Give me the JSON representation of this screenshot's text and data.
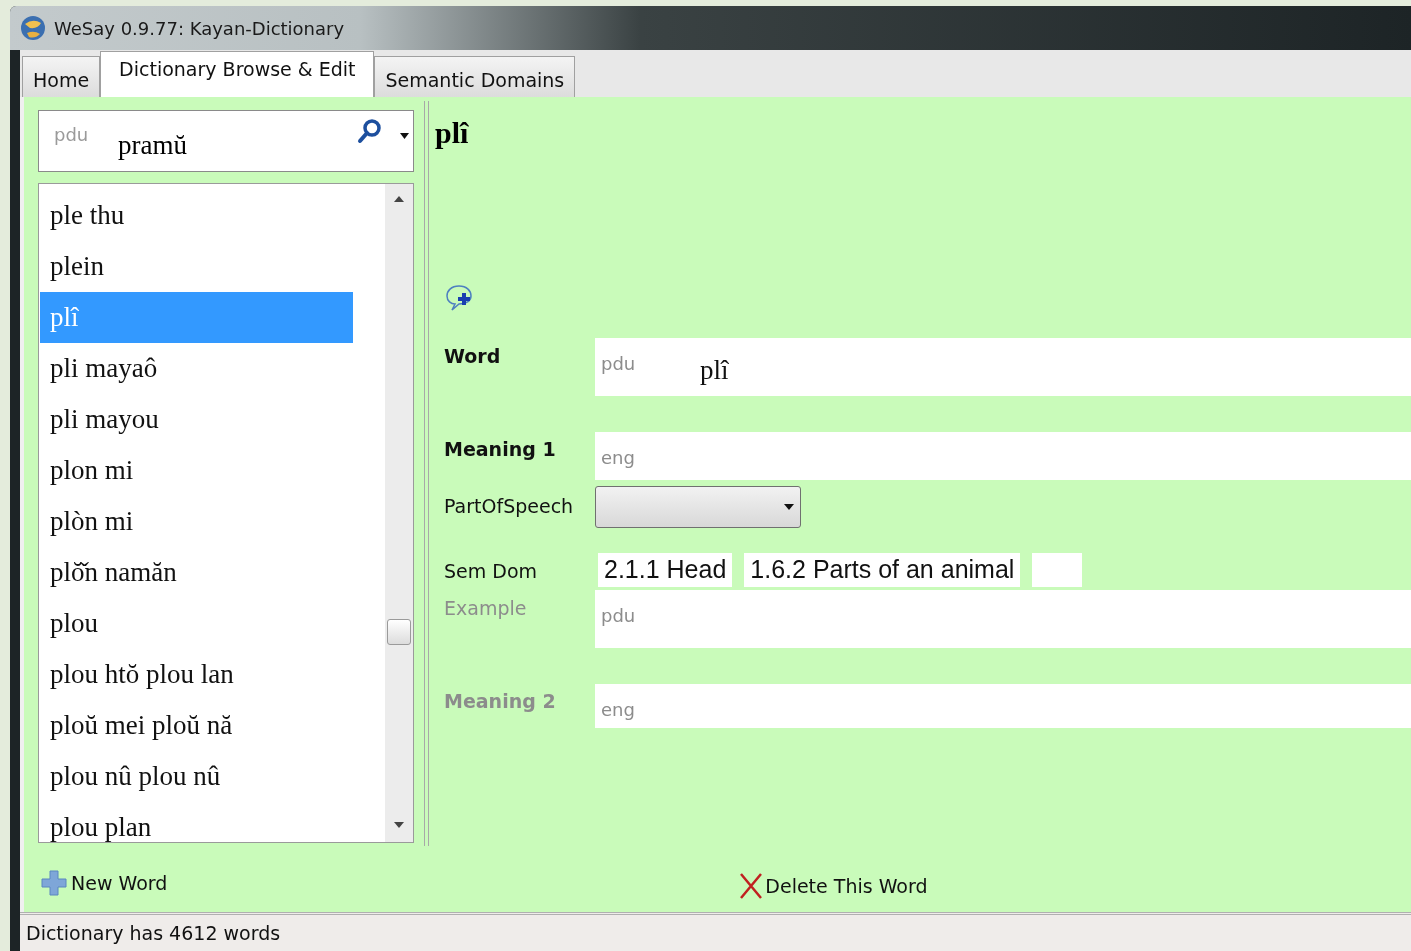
{
  "window": {
    "title": "WeSay 0.9.77: Kayan-Dictionary"
  },
  "tabs": [
    {
      "label": "Home",
      "selected": false
    },
    {
      "label": "Dictionary Browse & Edit",
      "selected": true
    },
    {
      "label": "Semantic Domains",
      "selected": false
    }
  ],
  "search": {
    "writing_system": "pdu",
    "value": "pramŭ"
  },
  "word_list": {
    "items": [
      {
        "text": "ple thu",
        "selected": false
      },
      {
        "text": "plein",
        "selected": false
      },
      {
        "text": "plî",
        "selected": true
      },
      {
        "text": "pli mayaô",
        "selected": false
      },
      {
        "text": "pli mayou",
        "selected": false
      },
      {
        "text": "plon mi",
        "selected": false
      },
      {
        "text": "plòn mi",
        "selected": false
      },
      {
        "text": "plŏ̌n namăn",
        "selected": false
      },
      {
        "text": "plou",
        "selected": false
      },
      {
        "text": "plou htŏ plou lan",
        "selected": false
      },
      {
        "text": "ploŭ mei ploŭ nă",
        "selected": false
      },
      {
        "text": "plou nû plou nû",
        "selected": false
      },
      {
        "text": "plou plan",
        "selected": false
      }
    ]
  },
  "entry": {
    "headword": "plî",
    "fields": [
      {
        "kind": "text",
        "label": "Word",
        "bold": true,
        "dimmed": false,
        "writing_system": "pdu",
        "value": "plî"
      },
      {
        "kind": "text",
        "label": "Meaning 1",
        "bold": true,
        "dimmed": false,
        "writing_system": "eng"
      },
      {
        "kind": "choice",
        "label": "PartOfSpeech",
        "bold": false,
        "dimmed": false
      },
      {
        "kind": "tags",
        "label": "Sem Dom",
        "bold": false,
        "dimmed": false,
        "tags": [
          "2.1.1 Head",
          "1.6.2 Parts of an animal"
        ]
      },
      {
        "kind": "text",
        "label": "Example",
        "bold": false,
        "dimmed": true,
        "writing_system": "pdu"
      },
      {
        "kind": "text",
        "label": "Meaning 2",
        "bold": true,
        "dimmed": true,
        "writing_system": "eng"
      }
    ]
  },
  "buttons": {
    "new_word": "New Word",
    "delete_word": "Delete This Word"
  },
  "status_bar": "Dictionary has 4612 words"
}
